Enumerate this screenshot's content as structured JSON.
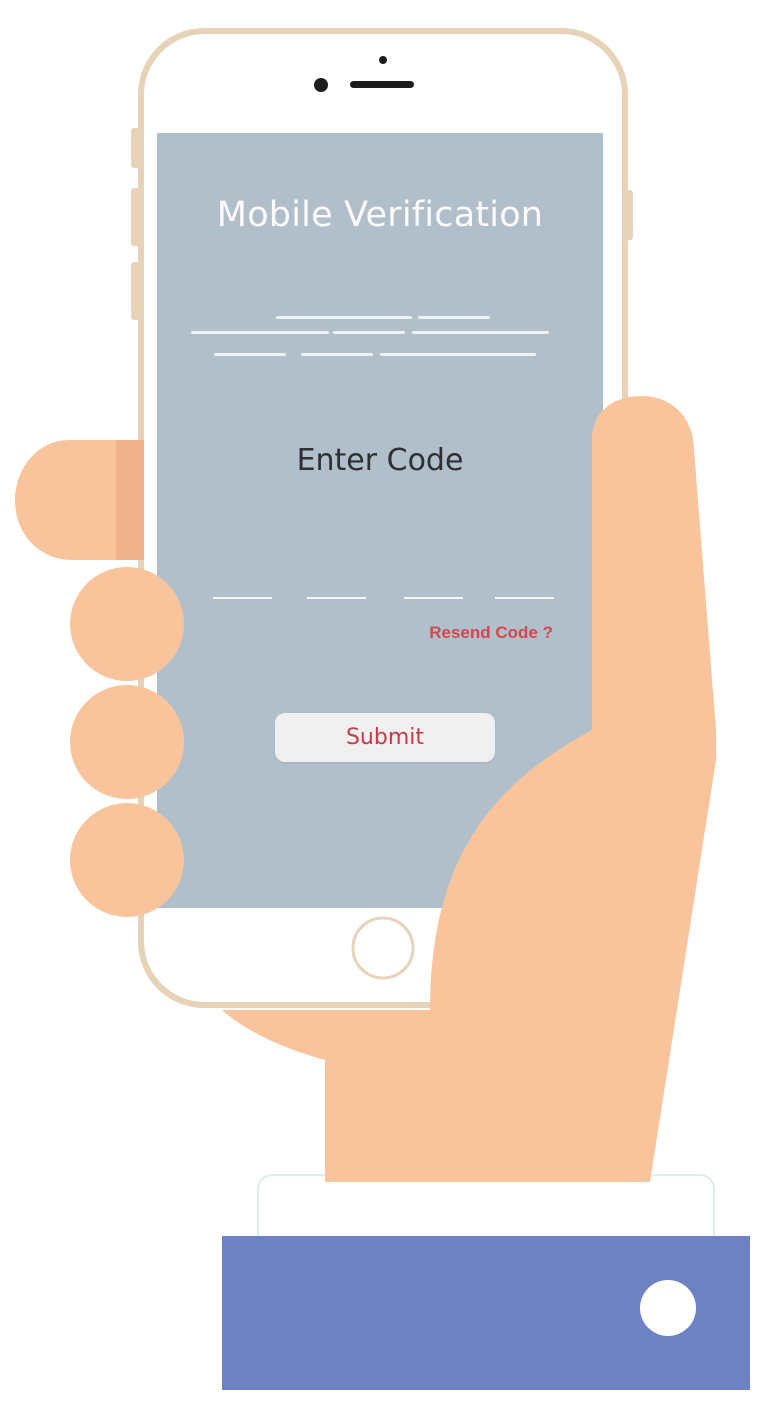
{
  "screen": {
    "title": "Mobile Verification",
    "prompt": "Enter Code",
    "code_slots": [
      "",
      "",
      "",
      ""
    ],
    "resend_label": "Resend Code ?",
    "submit_label": "Submit"
  },
  "colors": {
    "screen_background": "#b1bfcb",
    "phone_body": "#ffffff",
    "phone_frame_gold": "#e6d3b8",
    "skin": "#f9c49b",
    "skin_shadow": "#efb18c",
    "cuff": "#ffffff",
    "sleeve": "#6d82c2",
    "button_text": "#c63a45",
    "resend_text": "#d5474f"
  },
  "icons": {
    "front_camera": "camera-dot-icon",
    "earpiece": "speaker-slot-icon",
    "home_button": "home-button-icon",
    "sleeve_button": "sleeve-button-icon"
  }
}
